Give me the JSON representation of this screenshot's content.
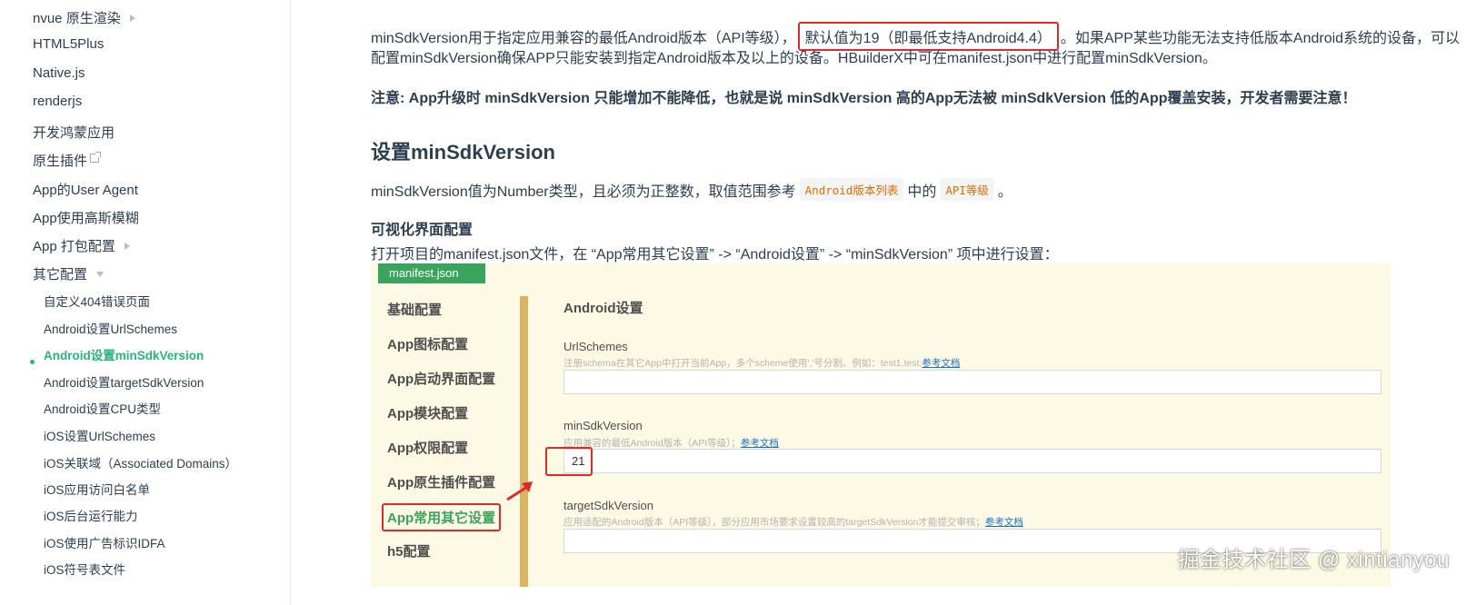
{
  "sidebar": {
    "items": [
      {
        "label": "nvue 原生渲染",
        "caret": "right"
      },
      {
        "label": "HTML5Plus"
      },
      {
        "label": "Native.js"
      },
      {
        "label": "renderjs"
      },
      {
        "label": "开发鸿蒙应用"
      },
      {
        "label": "原生插件",
        "icon": "external-link-icon"
      },
      {
        "label": "App的User Agent"
      },
      {
        "label": "App使用高斯模糊"
      },
      {
        "label": "App 打包配置",
        "caret": "right"
      },
      {
        "label": "其它配置",
        "caret": "down"
      }
    ],
    "subitems": [
      {
        "label": "自定义404错误页面"
      },
      {
        "label": "Android设置UrlSchemes"
      },
      {
        "label": "Android设置minSdkVersion",
        "active": true
      },
      {
        "label": "Android设置targetSdkVersion"
      },
      {
        "label": "Android设置CPU类型"
      },
      {
        "label": "iOS设置UrlSchemes"
      },
      {
        "label": "iOS关联域（Associated Domains）"
      },
      {
        "label": "iOS应用访问白名单"
      },
      {
        "label": "iOS后台运行能力"
      },
      {
        "label": "iOS使用广告标识IDFA"
      },
      {
        "label": "iOS符号表文件"
      }
    ]
  },
  "content": {
    "para1_a": "minSdkVersion用于指定应用兼容的最低Android版本（API等级），",
    "para1_highlight": "默认值为19（即最低支持Android4.4）",
    "para1_b": "。如果APP某些功能无法支持低版本Android系统的设备，可以",
    "para1_c": "配置minSdkVersion确保APP只能安装到指定Android版本及以上的设备。HBuilderX中可在manifest.json中进行配置minSdkVersion。",
    "note": "注意: App升级时 minSdkVersion 只能增加不能降低，也就是说 minSdkVersion 高的App无法被 minSdkVersion 低的App覆盖安装，开发者需要注意！",
    "heading": "设置minSdkVersion",
    "para2_a": "minSdkVersion值为Number类型，且必须为正整数，取值范围参考",
    "para2_code1": "Android版本列表",
    "para2_b": "中的",
    "para2_code2": "API等级",
    "para2_c": "。",
    "subheading": "可视化界面配置",
    "para3": "打开项目的manifest.json文件，在 “App常用其它设置” -> “Android设置” -> “minSdkVersion” 项中进行设置："
  },
  "panel": {
    "tab": "manifest.json",
    "nav": [
      "基础配置",
      "App图标配置",
      "App启动界面配置",
      "App模块配置",
      "App权限配置",
      "App原生插件配置",
      "App常用其它设置",
      "h5配置"
    ],
    "active_nav": "App常用其它设置",
    "section_title": "Android设置",
    "fields": [
      {
        "label": "UrlSchemes",
        "hint": "注册schema在其它App中打开当前App，多个scheme使用','号分割。例如：test1,test:",
        "link": "参考文档",
        "value": ""
      },
      {
        "label": "minSdkVersion",
        "hint": "应用兼容的最低Android版本（API等级）；",
        "link": "参考文档",
        "value": "21"
      },
      {
        "label": "targetSdkVersion",
        "hint": "应用适配的Android版本（API等级），部分应用市场要求设置较高的targetSdkVersion才能提交审核；",
        "link": "参考文档",
        "value": ""
      }
    ]
  },
  "watermark": "掘金技术社区 @ xintianyou",
  "colors": {
    "accent": "#2ab37b",
    "highlight_border": "#e02a2a",
    "panel_bg": "#fcf9e4",
    "tab_green": "#3aa45c",
    "code_text": "#e96900"
  }
}
